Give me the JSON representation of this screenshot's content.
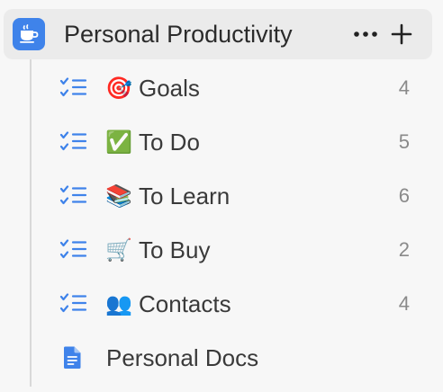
{
  "space": {
    "title": "Personal Productivity",
    "icon": "coffee-cup-icon",
    "accent_color": "#3f83ea",
    "more_icon": "more-horizontal-icon",
    "add_icon": "plus-icon"
  },
  "items": [
    {
      "type_icon": "checklist-icon",
      "emoji": "🎯",
      "label": "Goals",
      "count": "4"
    },
    {
      "type_icon": "checklist-icon",
      "emoji": "✅",
      "label": "To Do",
      "count": "5"
    },
    {
      "type_icon": "checklist-icon",
      "emoji": "📚",
      "label": "To Learn",
      "count": "6"
    },
    {
      "type_icon": "checklist-icon",
      "emoji": "🛒",
      "label": "To Buy",
      "count": "2"
    },
    {
      "type_icon": "checklist-icon",
      "emoji": "👥",
      "label": "Contacts",
      "count": "4"
    },
    {
      "type_icon": "document-icon",
      "label": "Personal Docs"
    }
  ]
}
